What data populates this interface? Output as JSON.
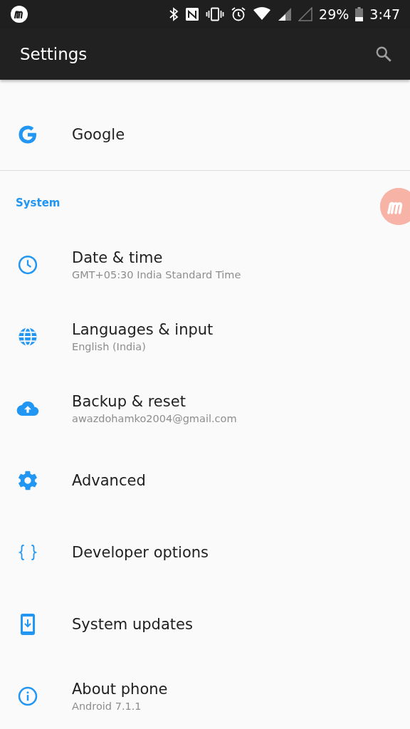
{
  "status_bar": {
    "battery": "29%",
    "time": "3:47"
  },
  "app_bar": {
    "title": "Settings"
  },
  "top_items": [
    {
      "title": "Google"
    }
  ],
  "sections": [
    {
      "header": "System",
      "items": [
        {
          "title": "Date & time",
          "subtitle": "GMT+05:30 India Standard Time"
        },
        {
          "title": "Languages & input",
          "subtitle": "English (India)"
        },
        {
          "title": "Backup & reset",
          "subtitle": "awazdohamko2004@gmail.com"
        },
        {
          "title": "Advanced"
        },
        {
          "title": "Developer options"
        },
        {
          "title": "System updates"
        },
        {
          "title": "About phone",
          "subtitle": "Android 7.1.1"
        }
      ]
    }
  ]
}
